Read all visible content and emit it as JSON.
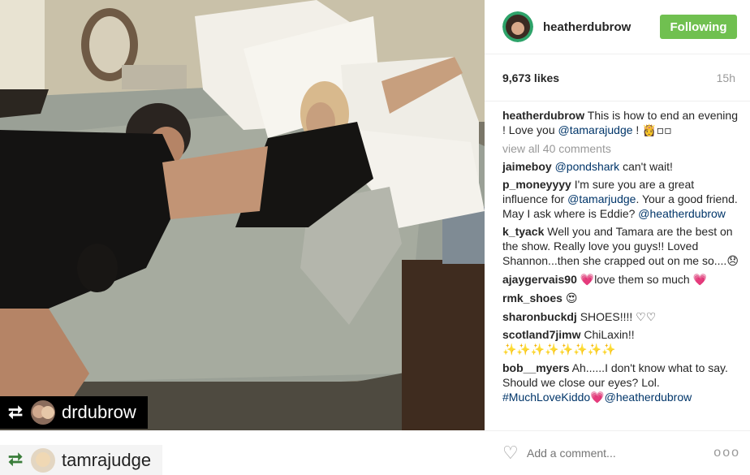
{
  "post": {
    "username": "heatherdubrow",
    "follow_label": "Following",
    "likes": "9,673 likes",
    "age": "15h",
    "caption_user": "heatherdubrow",
    "caption_text_1": "This is how to end an evening ! Love you",
    "caption_mention": "@tamarajudge",
    "caption_text_2": " !",
    "caption_emoji": "👸▫▫",
    "view_all": "view all 40 comments",
    "add_comment_placeholder": "Add a comment...",
    "more_label": "ooo"
  },
  "repost": {
    "dark_tag": "drdubrow",
    "light_tag": "tamrajudge",
    "icon": "repost-icon"
  },
  "comments": [
    {
      "user": "jaimeboy",
      "mention": "@pondshark",
      "text": " can't wait!"
    },
    {
      "user": "p_moneyyyy",
      "text_a": "I'm sure you are a great influence for ",
      "mention": "@tamarjudge",
      "text_b": ". Your a good friend. May I ask where is Eddie? ",
      "mention2": "@heatherdubrow"
    },
    {
      "user": "k_tyack",
      "text": "Well you and Tamara are the best on the show. Really love you guys!! Loved Shannon...then she crapped out on me so....",
      "emoji": "😞"
    },
    {
      "user": "ajaygervais90",
      "emoji1": "💗",
      "text": "love them so much ",
      "emoji2": "💗"
    },
    {
      "user": "rmk_shoes",
      "emoji": "😍"
    },
    {
      "user": "sharonbuckdj",
      "text": "SHOES!!!! ♡♡"
    },
    {
      "user": "scotland7jimw",
      "text": "ChiLaxin!!",
      "emoji": "✨✨✨✨✨✨✨✨"
    },
    {
      "user": "bob__myers",
      "text": "Ah......I don't know what to say. Should we close our eyes? Lol. ",
      "mention": "#MuchLoveKiddo",
      "emoji": "💗",
      "mention2": "@heatherdubrow"
    }
  ],
  "colors": {
    "follow_green": "#70c050",
    "mention_blue": "#003569",
    "muted_gray": "#999999"
  },
  "icons": [
    "heart-icon",
    "repost-icon",
    "avatar"
  ]
}
